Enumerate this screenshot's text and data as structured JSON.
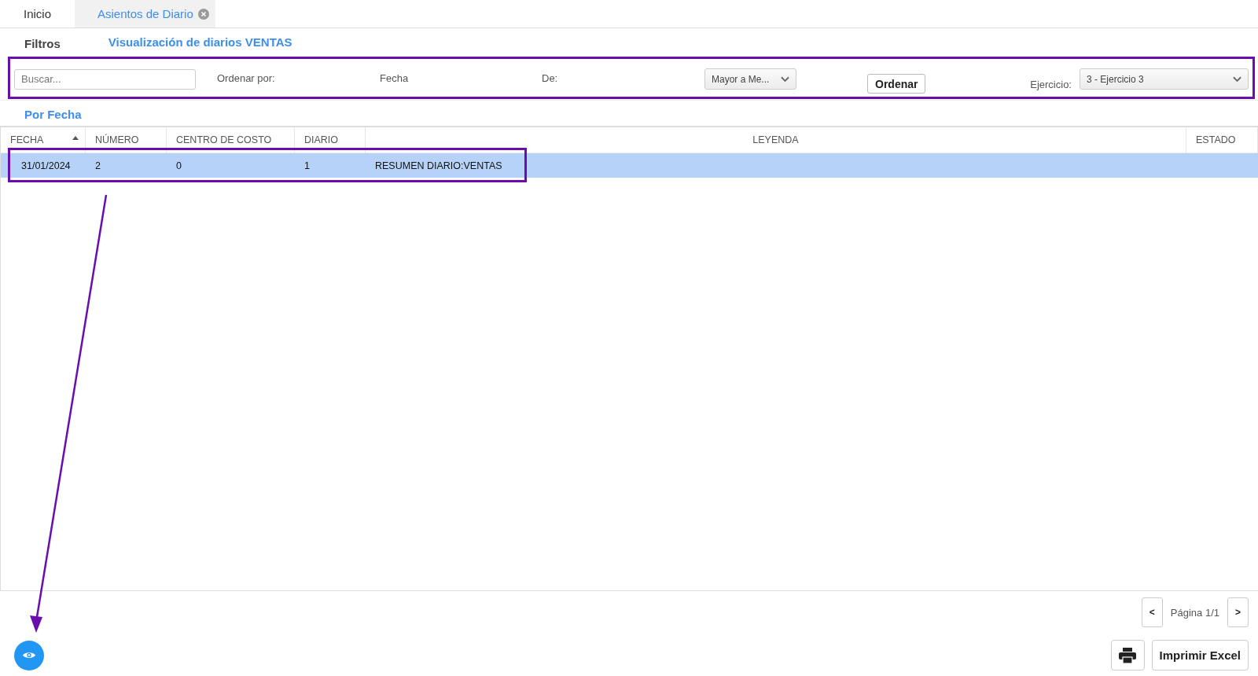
{
  "tabs": [
    {
      "label": "Inicio",
      "selected": false,
      "closable": false
    },
    {
      "label": "Asientos de Diario",
      "selected": true,
      "closable": true
    }
  ],
  "subtabs": [
    {
      "label": "Filtros",
      "selected": false
    },
    {
      "label": "Visualización de diarios VENTAS",
      "selected": true
    }
  ],
  "filters": {
    "search": {
      "placeholder": "Buscar..."
    },
    "order_label": "Ordenar por:",
    "order_value": "Fecha",
    "from_label": "De:",
    "direction": "Mayor a Me...",
    "order_button": "Ordenar",
    "year_label": "Ejercicio:",
    "year": "3 - Ejercicio 3"
  },
  "view_tabs": [
    {
      "label": "Por Fecha",
      "selected": true
    }
  ],
  "table": {
    "columns": [
      {
        "label": "FECHA",
        "sorted": true
      },
      {
        "label": "NÚMERO",
        "sorted": false
      },
      {
        "label": "CENTRO DE COSTO",
        "sorted": false
      },
      {
        "label": "DIARIO",
        "sorted": false
      },
      {
        "label": "LEYENDA",
        "sorted": false
      },
      {
        "label": "ESTADO",
        "sorted": false
      }
    ],
    "rows": [
      {
        "selected": true,
        "cells": [
          "31/01/2024",
          "2",
          "0",
          "1",
          "RESUMEN DIARIO:VENTAS",
          ""
        ]
      }
    ]
  },
  "pagination": {
    "prev": "<",
    "label": "Página 1/1",
    "next": ">"
  },
  "export_button": "Imprimir Excel"
}
